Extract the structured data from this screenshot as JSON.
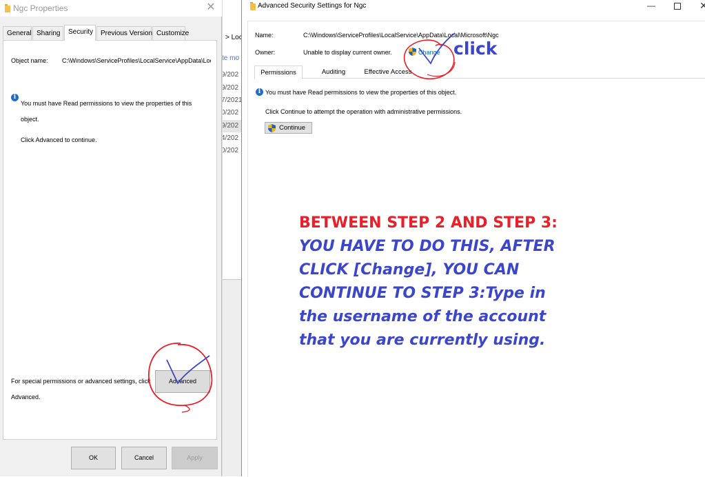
{
  "properties_dialog": {
    "title": "Ngc Properties",
    "close_glyph": "✕",
    "tabs": [
      "General",
      "Sharing",
      "Security",
      "Previous Versions",
      "Customize"
    ],
    "active_tab": "Security",
    "object_name_label": "Object name:",
    "object_name_value": "C:\\Windows\\ServiceProfiles\\LocalService\\AppData\\Loc",
    "info_message": "You must have Read permissions to view the properties of this object.",
    "advanced_hint": "Click Advanced to continue.",
    "special_permissions_text": "For special permissions or advanced settings, click Advanced.",
    "advanced_button": "Advanced",
    "ok_button": "OK",
    "cancel_button": "Cancel",
    "apply_button": "Apply"
  },
  "explorer_background": {
    "breadcrumb": "> Loc",
    "column_header": "te mo",
    "dates": [
      "9/202",
      "9/202",
      "7/2021",
      "0/202",
      "9/202",
      "4/202",
      "0/202"
    ]
  },
  "advanced_dialog": {
    "title": "Advanced Security Settings for Ngc",
    "name_label": "Name:",
    "name_value": "C:\\Windows\\ServiceProfiles\\LocalService\\AppData\\Local\\Microsoft\\Ngc",
    "owner_label": "Owner:",
    "owner_value": "Unable to display current owner.",
    "change_link": "Change",
    "tabs": [
      "Permissions",
      "Auditing",
      "Effective Access"
    ],
    "active_tab": "Permissions",
    "info_message": "You must have Read permissions to view the properties of this object.",
    "continue_message": "Click Continue to attempt the operation with administrative permissions.",
    "continue_button": "Continue",
    "window_controls": {
      "minimize": "—",
      "close": "✕"
    }
  },
  "annotation": {
    "click_label": "click",
    "headline": "BETWEEN STEP 2 AND STEP 3:",
    "body": "YOU HAVE TO DO THIS, AFTER CLICK [Change], YOU CAN CONTINUE TO STEP 3:Type in the username of the account that you are currently using.",
    "circle_color": "#e8202a",
    "check_color": "#3c46c8"
  },
  "colors": {
    "info_blue": "#1e6ec8",
    "link_blue": "#0066cc",
    "folder_yellow": "#f3c14b"
  },
  "icons": {
    "folder": "folder-icon",
    "info": "info-icon",
    "uac_shield": "uac-shield-icon"
  }
}
